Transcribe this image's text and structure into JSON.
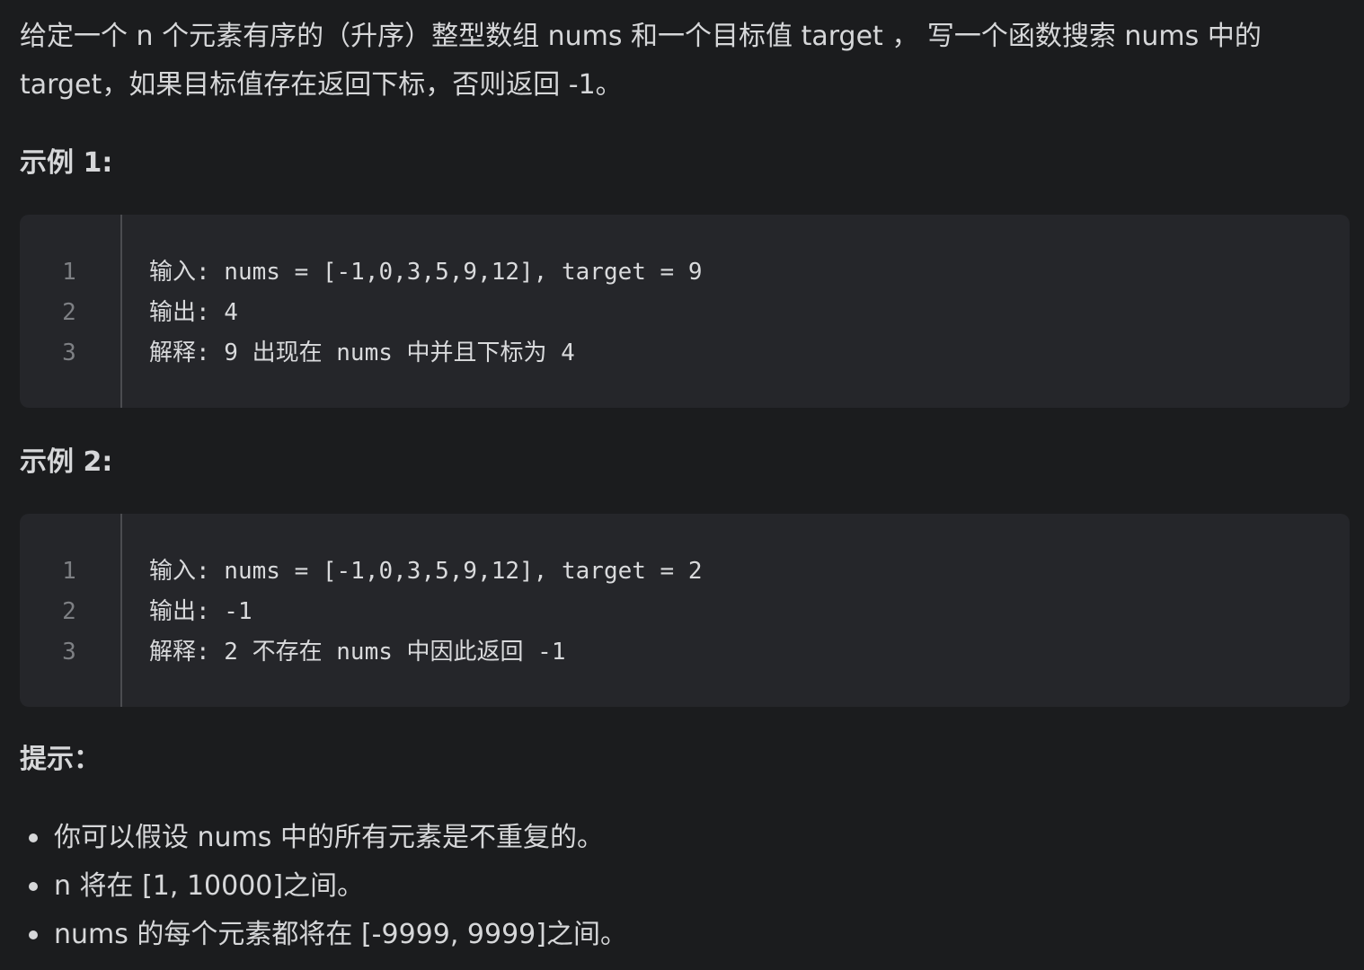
{
  "description": "给定一个 n 个元素有序的（升序）整型数组 nums 和一个目标值 target ， 写一个函数搜索 nums 中的 target，如果目标值存在返回下标，否则返回 -1。",
  "example1": {
    "heading": "示例 1:",
    "line_numbers": [
      "1",
      "2",
      "3"
    ],
    "lines": [
      "输入: nums = [-1,0,3,5,9,12], target = 9",
      "输出: 4",
      "解释: 9 出现在 nums 中并且下标为 4"
    ]
  },
  "example2": {
    "heading": "示例 2:",
    "line_numbers": [
      "1",
      "2",
      "3"
    ],
    "lines": [
      "输入: nums = [-1,0,3,5,9,12], target = 2",
      "输出: -1",
      "解释: 2 不存在 nums 中因此返回 -1"
    ]
  },
  "tips": {
    "heading": "提示：",
    "items": [
      "你可以假设 nums 中的所有元素是不重复的。",
      "n 将在 [1, 10000]之间。",
      "nums 的每个元素都将在 [-9999, 9999]之间。"
    ]
  }
}
